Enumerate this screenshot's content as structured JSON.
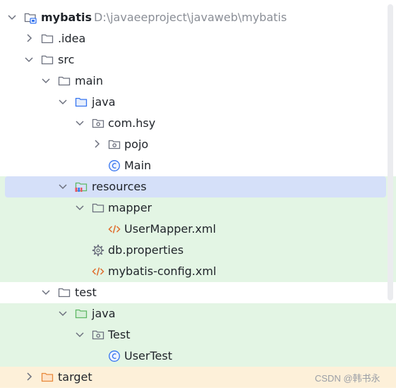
{
  "project": {
    "name": "mybatis",
    "path": "D:\\javaeeproject\\javaweb\\mybatis",
    "icon": "project-module-icon"
  },
  "tree": {
    "idea": "idea",
    "src": "src",
    "main": "main",
    "main_java": "java",
    "package": "com.hsy",
    "pojo": "pojo",
    "main_class": "Main",
    "resources": "resources",
    "mapper": "mapper",
    "user_mapper": "UserMapper.xml",
    "db_properties": "db.properties",
    "mybatis_config": "mybatis-config.xml",
    "test": "test",
    "test_java": "java",
    "test_package": "Test",
    "user_test": "UserTest",
    "target": "target"
  },
  "colors": {
    "selection": "#d5e0f9",
    "resource_highlight": "#e3f5e4",
    "excluded_highlight": "#fdf0d9",
    "source_folder": "#3574f0",
    "test_folder": "#5fb865",
    "xml": "#e06c2c",
    "excluded_folder": "#e8883a"
  },
  "watermark": "CSDN @韩书永"
}
